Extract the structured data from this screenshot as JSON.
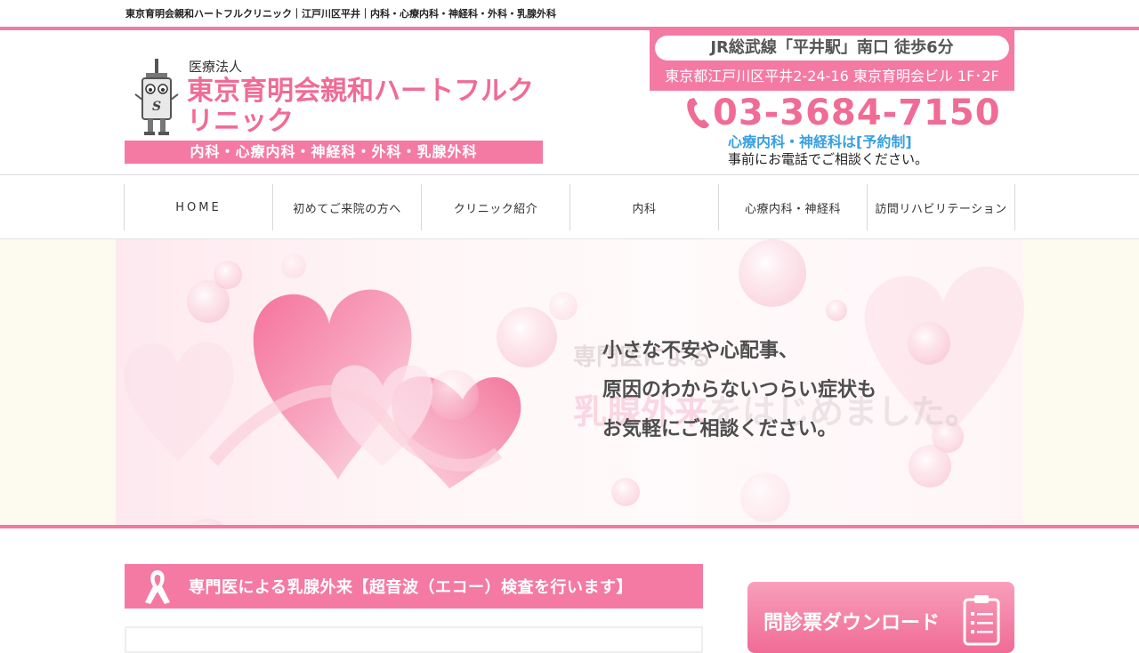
{
  "topline": {
    "text": "東京育明会親和ハートフルクリニック｜江戸川区平井｜内科・心療内科・神経科・外科・乳腺外科"
  },
  "header": {
    "corp": "医療法人",
    "clinic_name": "東京育明会親和ハートフルクリニック",
    "departments": "内科・心療内科・神経科・外科・乳腺外科",
    "access": "JR総武線「平井駅」南口 徒歩6分",
    "address": "東京都江戸川区平井2-24-16 東京育明会ビル 1F･2F",
    "phone": "03-3684-7150",
    "reserve": "心療内科・神経科は[予約制]",
    "reserve_sub": "事前にお電話でご相談ください。"
  },
  "nav": {
    "items": [
      {
        "label": "HOME"
      },
      {
        "label": "初めてご来院の方へ"
      },
      {
        "label": "クリニック紹介"
      },
      {
        "label": "内科"
      },
      {
        "label": "心療内科・神経科"
      },
      {
        "label": "訪問リハビリテーション"
      }
    ]
  },
  "hero": {
    "ghost_line1": "専門医による",
    "ghost_line2_pink": "乳腺外来",
    "ghost_line2_gray": "をはじめました。",
    "copy_lines": [
      "小さな不安や心配事、",
      "原因のわからないつらい症状も",
      "お気軽にご相談ください。"
    ]
  },
  "section": {
    "title": "専門医による乳腺外来【超音波（エコー）検査を行います】"
  },
  "sidebar": {
    "download_label": "問診票ダウンロード"
  },
  "colors": {
    "brand_pink": "#f47aa3",
    "text_pink": "#f06b95",
    "accent_blue": "#3aa0e0"
  },
  "icons": [
    "syringe-mascot-icon",
    "phone-icon",
    "pink-ribbon-icon",
    "clipboard-icon"
  ]
}
